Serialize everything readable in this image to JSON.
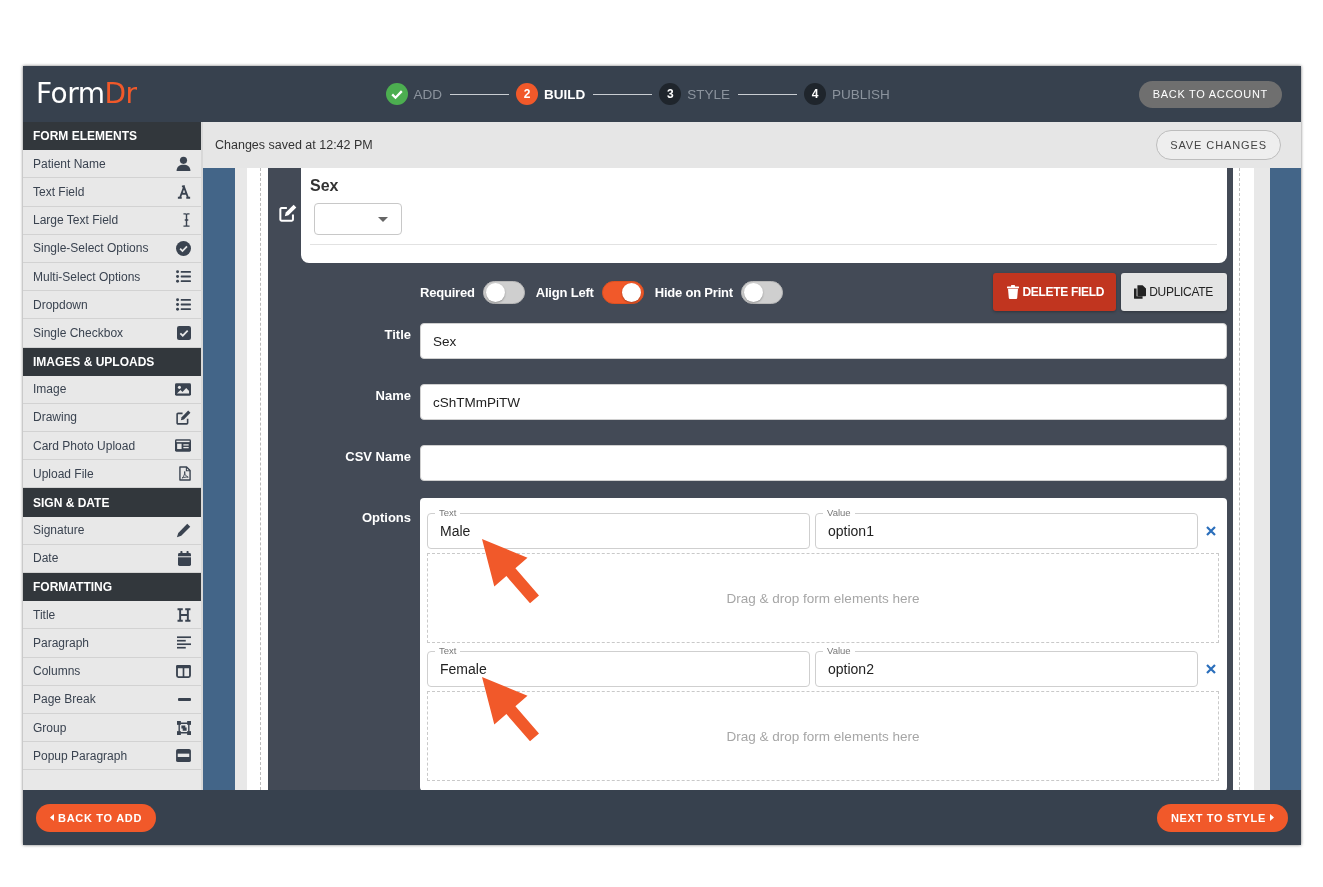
{
  "header": {
    "logo": {
      "text": "Form",
      "accent": "Dr"
    },
    "steps": [
      {
        "label": "ADD",
        "completed": true,
        "selected": false
      },
      {
        "number": "2",
        "label": "BUILD",
        "completed": false,
        "selected": true
      },
      {
        "number": "3",
        "label": "STYLE",
        "completed": false,
        "selected": false
      },
      {
        "number": "4",
        "label": "PUBLISH",
        "completed": false,
        "selected": false
      }
    ],
    "account_button": "BACK TO ACCOUNT"
  },
  "sidebar": {
    "sections": [
      {
        "title": "FORM ELEMENTS",
        "items": [
          {
            "label": "Patient Name"
          },
          {
            "label": "Text Field"
          },
          {
            "label": "Large Text Field"
          },
          {
            "label": "Single-Select Options"
          },
          {
            "label": "Multi-Select Options"
          },
          {
            "label": "Dropdown"
          },
          {
            "label": "Single Checkbox"
          }
        ]
      },
      {
        "title": "IMAGES & UPLOADS",
        "items": [
          {
            "label": "Image"
          },
          {
            "label": "Drawing"
          },
          {
            "label": "Card Photo Upload"
          },
          {
            "label": "Upload File"
          }
        ]
      },
      {
        "title": "SIGN & DATE",
        "items": [
          {
            "label": "Signature"
          },
          {
            "label": "Date"
          }
        ]
      },
      {
        "title": "FORMATTING",
        "items": [
          {
            "label": "Title"
          },
          {
            "label": "Paragraph"
          },
          {
            "label": "Columns"
          },
          {
            "label": "Page Break"
          },
          {
            "label": "Group"
          },
          {
            "label": "Popup Paragraph"
          }
        ]
      }
    ]
  },
  "save_bar": {
    "status": "Changes saved at 12:42 PM",
    "save_button": "SAVE CHANGES"
  },
  "editor": {
    "field_preview": {
      "title": "Sex"
    },
    "toggles": [
      {
        "label": "Required",
        "on": false
      },
      {
        "label": "Align Left",
        "on": true
      },
      {
        "label": "Hide on Print",
        "on": false
      }
    ],
    "actions": [
      {
        "label": "DELETE FIELD",
        "kind": "delete"
      },
      {
        "label": "DUPLICATE",
        "kind": "duplicate"
      }
    ],
    "properties": [
      {
        "label": "Title",
        "value": "Sex"
      },
      {
        "label": "Name",
        "value": "cShTMmPiTW"
      },
      {
        "label": "CSV Name"
      }
    ],
    "options": {
      "label": "Options",
      "items": [
        {
          "text_caption": "Text",
          "text": "Male",
          "value_caption": "Value",
          "value": "option1",
          "drop_hint": "Drag & drop form elements here",
          "callout_arrow": true
        },
        {
          "text_caption": "Text",
          "text": "Female",
          "value_caption": "Value",
          "value": "option2",
          "drop_hint": "Drag & drop form elements here",
          "callout_arrow": true
        }
      ]
    }
  },
  "footer": {
    "back_button": "BACK TO ADD",
    "next_button": "NEXT TO STYLE"
  }
}
